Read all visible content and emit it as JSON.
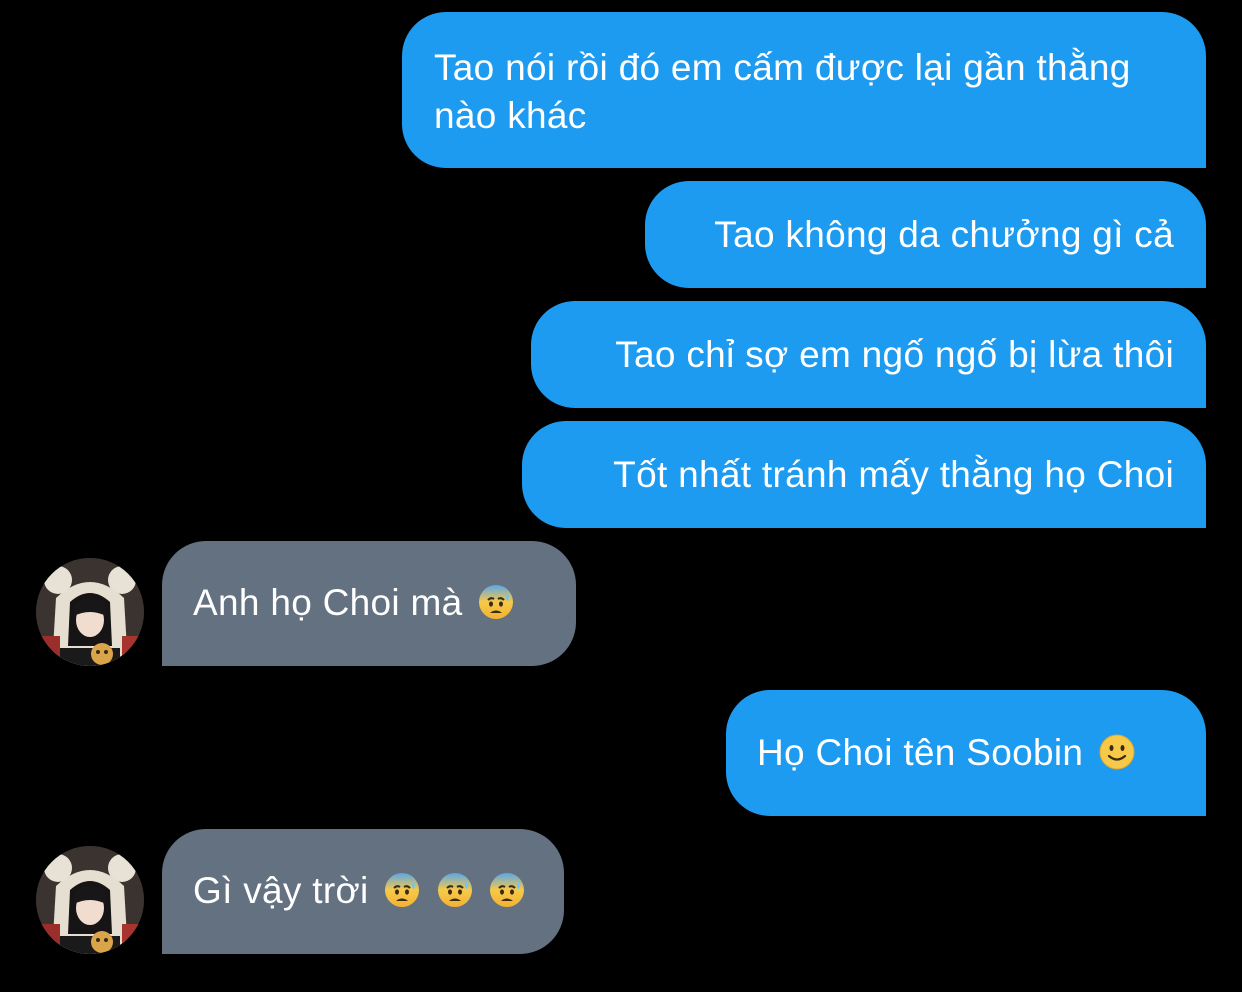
{
  "conversation": {
    "messages": [
      {
        "from": "me",
        "text": "Tao nói rồi đó em cấm được lại gần thằng nào khác"
      },
      {
        "from": "me",
        "text": "Tao không da chưởng gì cả"
      },
      {
        "from": "me",
        "text": "Tao chỉ sợ em ngố ngố bị lừa thôi"
      },
      {
        "from": "me",
        "text": "Tốt nhất tránh mấy thằng họ Choi"
      },
      {
        "from": "other",
        "text": "Anh họ Choi mà",
        "emoji": [
          "anxious-sweat-face"
        ]
      },
      {
        "from": "me",
        "text": "Họ Choi tên Soobin",
        "emoji": [
          "slightly-smiling-face"
        ]
      },
      {
        "from": "other",
        "text": "Gì vậy trời",
        "emoji": [
          "anxious-sweat-face",
          "anxious-sweat-face",
          "anxious-sweat-face"
        ]
      }
    ]
  },
  "colors": {
    "background": "#000000",
    "sent_bubble": "#1d9bf0",
    "received_bubble": "#637181",
    "text": "#ffffff"
  }
}
